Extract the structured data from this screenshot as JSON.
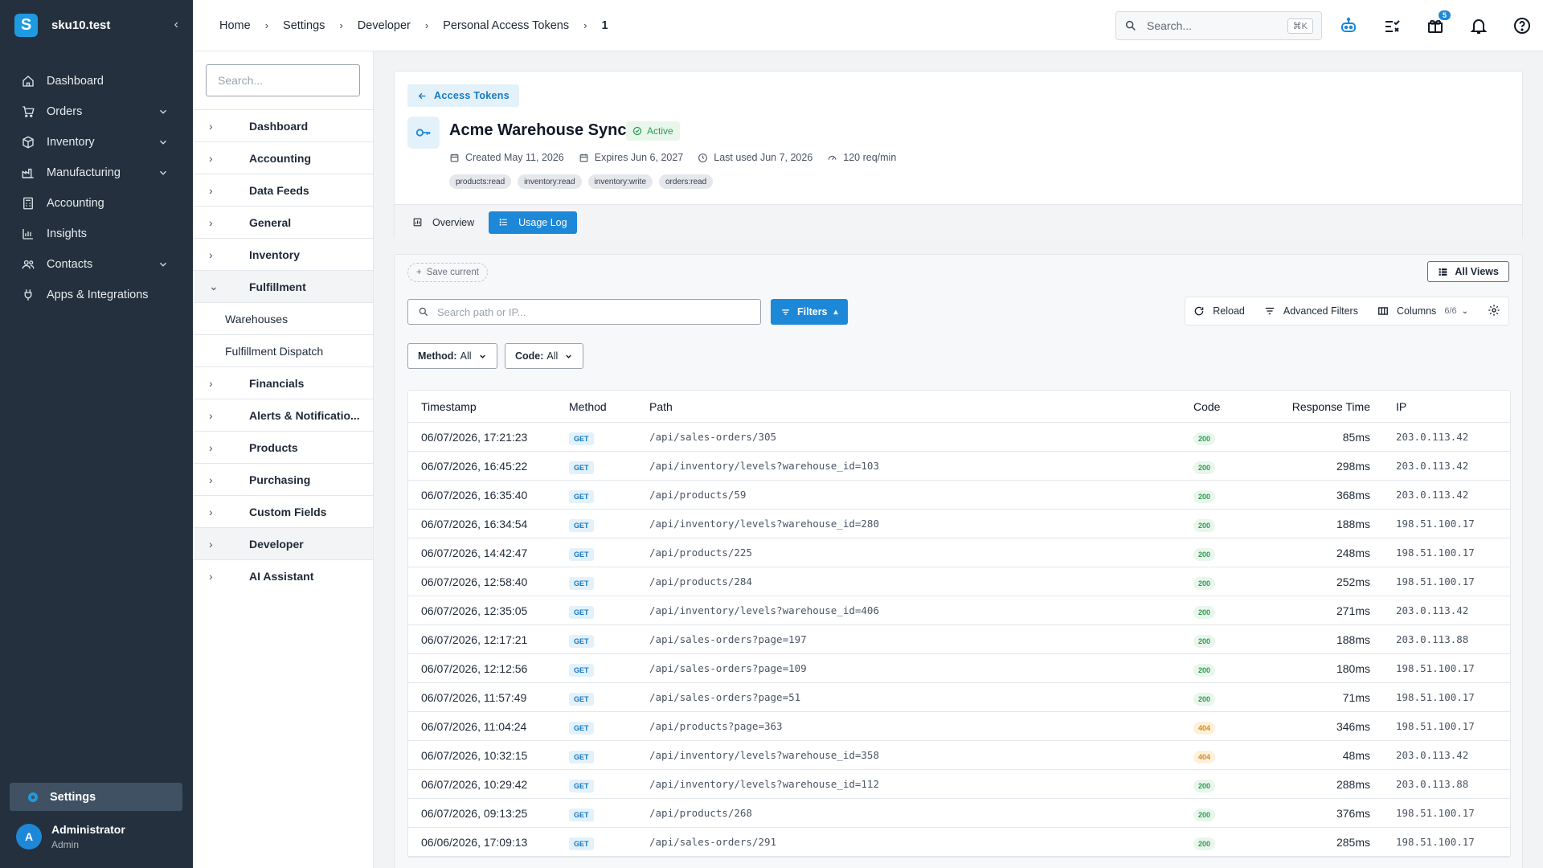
{
  "app": {
    "name": "sku10.test",
    "logo_letter": "S"
  },
  "sidebar": {
    "items": [
      {
        "label": "Dashboard",
        "icon": "home-icon",
        "has_children": false
      },
      {
        "label": "Orders",
        "icon": "cart-icon",
        "has_children": true
      },
      {
        "label": "Inventory",
        "icon": "box-icon",
        "has_children": true
      },
      {
        "label": "Manufacturing",
        "icon": "factory-icon",
        "has_children": true
      },
      {
        "label": "Accounting",
        "icon": "calculator-icon",
        "has_children": false
      },
      {
        "label": "Insights",
        "icon": "chart-icon",
        "has_children": false
      },
      {
        "label": "Contacts",
        "icon": "contacts-icon",
        "has_children": true
      },
      {
        "label": "Apps & Integrations",
        "icon": "plug-icon",
        "has_children": false
      }
    ],
    "settings_label": "Settings",
    "user": {
      "initial": "A",
      "name": "Administrator",
      "role": "Admin"
    }
  },
  "topbar": {
    "breadcrumbs": [
      "Home",
      "Settings",
      "Developer",
      "Personal Access Tokens",
      "1"
    ],
    "search_placeholder": "Search...",
    "search_shortcut": "⌘K",
    "gift_badge": "5"
  },
  "settings_nav": {
    "search_placeholder": "Search...",
    "items": [
      {
        "label": "Dashboard",
        "arrow": "›"
      },
      {
        "label": "Accounting",
        "arrow": "›"
      },
      {
        "label": "Data Feeds",
        "arrow": "›"
      },
      {
        "label": "General",
        "arrow": "›"
      },
      {
        "label": "Inventory",
        "arrow": "›"
      },
      {
        "label": "Fulfillment",
        "arrow": "⌄"
      }
    ],
    "sub_items": [
      "Warehouses",
      "Fulfillment Dispatch"
    ],
    "items_after": [
      {
        "label": "Financials",
        "arrow": "›"
      },
      {
        "label": "Alerts & Notificatio...",
        "arrow": "›"
      },
      {
        "label": "Products",
        "arrow": "›"
      },
      {
        "label": "Purchasing",
        "arrow": "›"
      },
      {
        "label": "Custom Fields",
        "arrow": "›"
      },
      {
        "label": "Developer",
        "arrow": "›"
      },
      {
        "label": "AI Assistant",
        "arrow": "›"
      }
    ]
  },
  "token": {
    "back_label": "Access Tokens",
    "name": "Acme Warehouse Sync",
    "status": "Active",
    "created": "Created May 11, 2026",
    "expires": "Expires Jun 6, 2027",
    "last_used": "Last used Jun 7, 2026",
    "rate": "120 req/min",
    "scopes": [
      "products:read",
      "inventory:read",
      "inventory:write",
      "orders:read"
    ],
    "tabs": {
      "overview": "Overview",
      "usage_log": "Usage Log"
    }
  },
  "log": {
    "save_current": "Save current",
    "all_views": "All Views",
    "search_placeholder": "Search path or IP...",
    "filters_label": "Filters",
    "reload_label": "Reload",
    "advanced_filters_label": "Advanced Filters",
    "columns_label": "Columns",
    "columns_count": "6/6",
    "method_filter": {
      "key": "Method:",
      "value": "All"
    },
    "code_filter": {
      "key": "Code:",
      "value": "All"
    },
    "headers": [
      "Timestamp",
      "Method",
      "Path",
      "Code",
      "Response Time",
      "IP"
    ],
    "rows": [
      {
        "ts": "06/07/2026, 17:21:23",
        "method": "GET",
        "path": "/api/sales-orders/305",
        "code": "200",
        "rt": "85ms",
        "ip": "203.0.113.42"
      },
      {
        "ts": "06/07/2026, 16:45:22",
        "method": "GET",
        "path": "/api/inventory/levels?warehouse_id=103",
        "code": "200",
        "rt": "298ms",
        "ip": "203.0.113.42"
      },
      {
        "ts": "06/07/2026, 16:35:40",
        "method": "GET",
        "path": "/api/products/59",
        "code": "200",
        "rt": "368ms",
        "ip": "203.0.113.42"
      },
      {
        "ts": "06/07/2026, 16:34:54",
        "method": "GET",
        "path": "/api/inventory/levels?warehouse_id=280",
        "code": "200",
        "rt": "188ms",
        "ip": "198.51.100.17"
      },
      {
        "ts": "06/07/2026, 14:42:47",
        "method": "GET",
        "path": "/api/products/225",
        "code": "200",
        "rt": "248ms",
        "ip": "198.51.100.17"
      },
      {
        "ts": "06/07/2026, 12:58:40",
        "method": "GET",
        "path": "/api/products/284",
        "code": "200",
        "rt": "252ms",
        "ip": "198.51.100.17"
      },
      {
        "ts": "06/07/2026, 12:35:05",
        "method": "GET",
        "path": "/api/inventory/levels?warehouse_id=406",
        "code": "200",
        "rt": "271ms",
        "ip": "203.0.113.42"
      },
      {
        "ts": "06/07/2026, 12:17:21",
        "method": "GET",
        "path": "/api/sales-orders?page=197",
        "code": "200",
        "rt": "188ms",
        "ip": "203.0.113.88"
      },
      {
        "ts": "06/07/2026, 12:12:56",
        "method": "GET",
        "path": "/api/sales-orders?page=109",
        "code": "200",
        "rt": "180ms",
        "ip": "198.51.100.17"
      },
      {
        "ts": "06/07/2026, 11:57:49",
        "method": "GET",
        "path": "/api/sales-orders?page=51",
        "code": "200",
        "rt": "71ms",
        "ip": "198.51.100.17"
      },
      {
        "ts": "06/07/2026, 11:04:24",
        "method": "GET",
        "path": "/api/products?page=363",
        "code": "404",
        "rt": "346ms",
        "ip": "198.51.100.17"
      },
      {
        "ts": "06/07/2026, 10:32:15",
        "method": "GET",
        "path": "/api/inventory/levels?warehouse_id=358",
        "code": "404",
        "rt": "48ms",
        "ip": "203.0.113.42"
      },
      {
        "ts": "06/07/2026, 10:29:42",
        "method": "GET",
        "path": "/api/inventory/levels?warehouse_id=112",
        "code": "200",
        "rt": "288ms",
        "ip": "203.0.113.88"
      },
      {
        "ts": "06/07/2026, 09:13:25",
        "method": "GET",
        "path": "/api/products/268",
        "code": "200",
        "rt": "376ms",
        "ip": "198.51.100.17"
      },
      {
        "ts": "06/06/2026, 17:09:13",
        "method": "GET",
        "path": "/api/sales-orders/291",
        "code": "200",
        "rt": "285ms",
        "ip": "198.51.100.17"
      }
    ]
  }
}
